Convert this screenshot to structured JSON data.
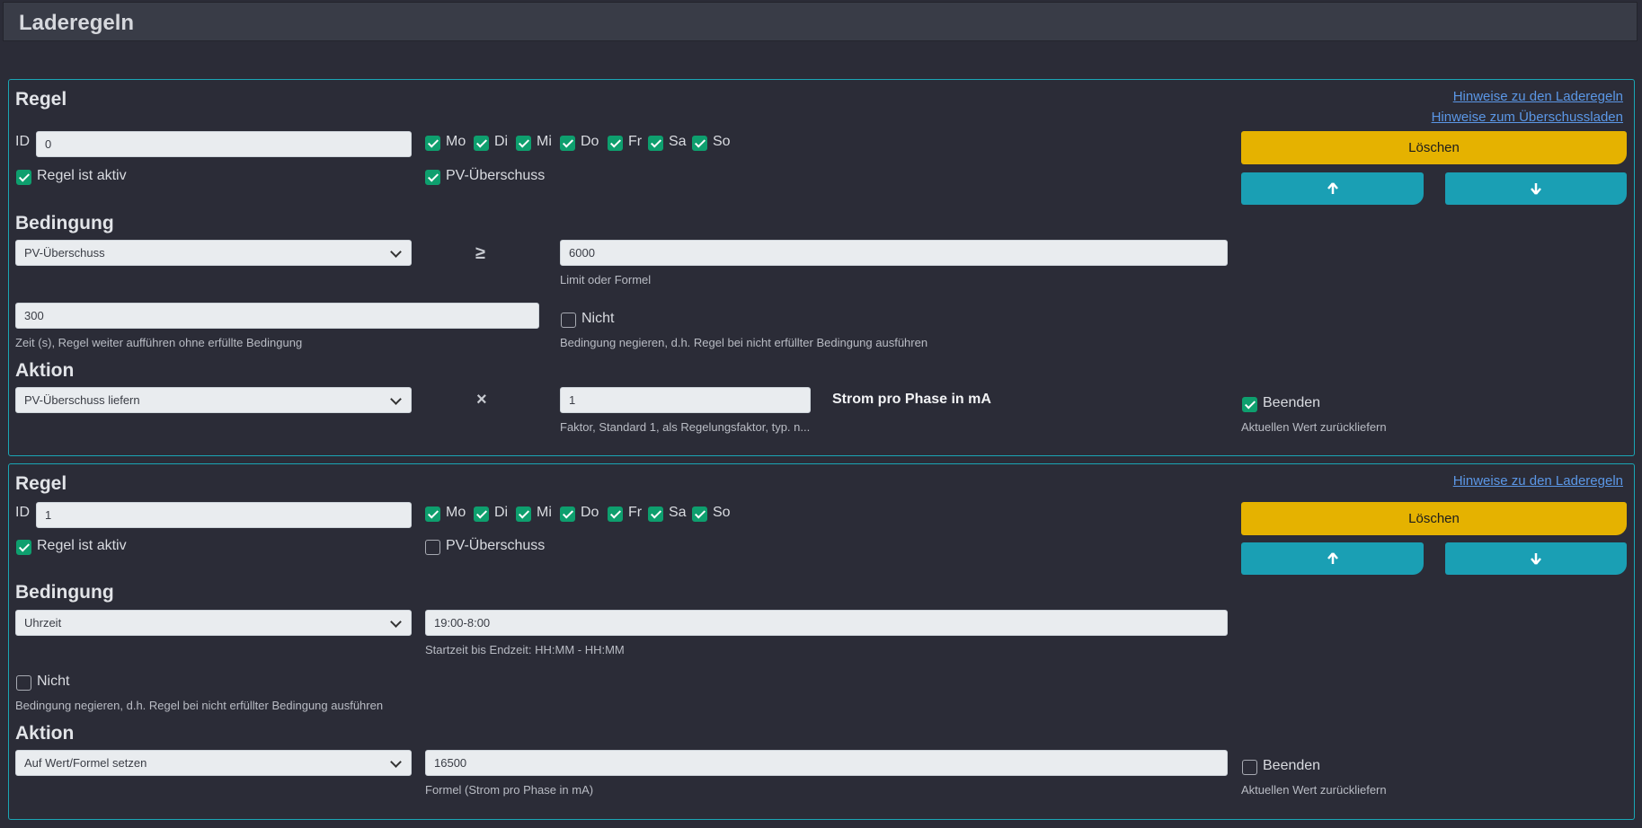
{
  "page": {
    "title": "Laderegeln"
  },
  "rule1": {
    "heading": "Regel",
    "links": [
      "Hinweise zu den Laderegeln",
      "Hinweise zum Überschussladen"
    ],
    "id_label": "ID",
    "id_value": "0",
    "days": [
      {
        "label": "Mo",
        "checked": true
      },
      {
        "label": "Di",
        "checked": true
      },
      {
        "label": "Mi",
        "checked": true
      },
      {
        "label": "Do",
        "checked": true
      },
      {
        "label": "Fr",
        "checked": true
      },
      {
        "label": "Sa",
        "checked": true
      },
      {
        "label": "So",
        "checked": true
      }
    ],
    "active_label": "Regel ist aktiv",
    "active_checked": true,
    "pv_label": "PV-Überschuss",
    "pv_checked": true,
    "delete_label": "Löschen",
    "condition_heading": "Bedingung",
    "condition_select": "PV-Überschuss",
    "operator": "≥",
    "limit_value": "6000",
    "limit_help": "Limit oder Formel",
    "time_value": "300",
    "time_help": "Zeit (s), Regel weiter aufführen ohne erfüllte Bedingung",
    "not_label": "Nicht",
    "not_checked": false,
    "not_help": "Bedingung negieren, d.h. Regel bei nicht erfüllter Bedingung ausführen",
    "action_heading": "Aktion",
    "action_select": "PV-Überschuss liefern",
    "action_operator": "×",
    "factor_value": "1",
    "factor_help": "Faktor, Standard 1, als Regelungsfaktor, typ. n...",
    "unit_label": "Strom pro Phase in mA",
    "end_label": "Beenden",
    "end_checked": true,
    "end_help": "Aktuellen Wert zurückliefern"
  },
  "rule2": {
    "heading": "Regel",
    "links": [
      "Hinweise zu den Laderegeln"
    ],
    "id_label": "ID",
    "id_value": "1",
    "days": [
      {
        "label": "Mo",
        "checked": true
      },
      {
        "label": "Di",
        "checked": true
      },
      {
        "label": "Mi",
        "checked": true
      },
      {
        "label": "Do",
        "checked": true
      },
      {
        "label": "Fr",
        "checked": true
      },
      {
        "label": "Sa",
        "checked": true
      },
      {
        "label": "So",
        "checked": true
      }
    ],
    "active_label": "Regel ist aktiv",
    "active_checked": true,
    "pv_label": "PV-Überschuss",
    "pv_checked": false,
    "delete_label": "Löschen",
    "condition_heading": "Bedingung",
    "condition_select": "Uhrzeit",
    "time_range_value": "19:00-8:00",
    "time_range_help": "Startzeit bis Endzeit: HH:MM - HH:MM",
    "not_label": "Nicht",
    "not_checked": false,
    "not_help": "Bedingung negieren, d.h. Regel bei nicht erfüllter Bedingung ausführen",
    "action_heading": "Aktion",
    "action_select": "Auf Wert/Formel setzen",
    "formula_value": "16500",
    "formula_help": "Formel (Strom pro Phase in mA)",
    "end_label": "Beenden",
    "end_checked": false,
    "end_help": "Aktuellen Wert zurückliefern"
  }
}
